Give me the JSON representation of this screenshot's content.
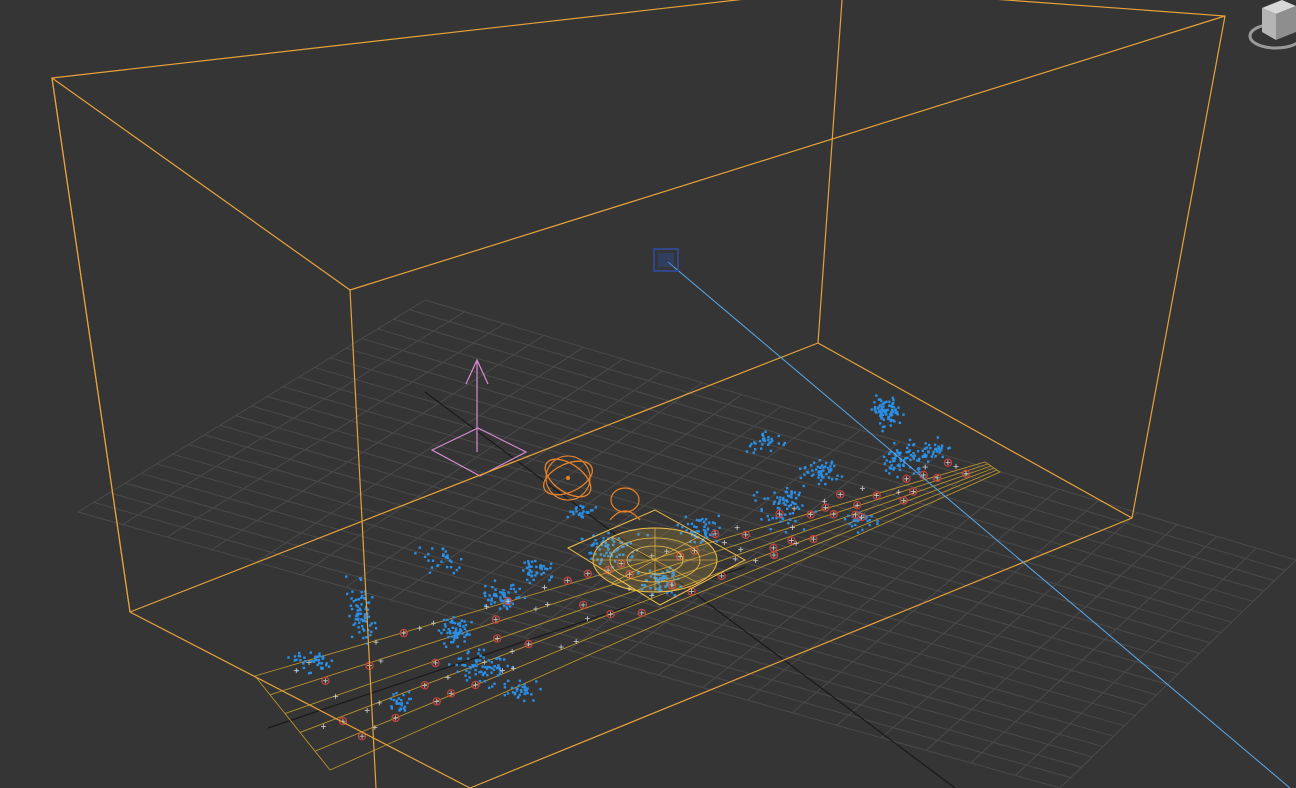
{
  "app": "3D viewport",
  "viewport": {
    "name": "perspective-viewport",
    "background": "#353535"
  },
  "colors": {
    "grid": "#4a4a4a",
    "bounding_box": "#e6a23a",
    "strip": "#b8922e",
    "particles": "#2b8fe6",
    "markers": "#c9413c",
    "marker_cross": "#cfcfcf",
    "light_ray": "#5aa8e6",
    "helper_gizmo": "#d98ad4",
    "selected_object": "#f2c04a",
    "camera_target": "#2e4fa8"
  },
  "icons": {
    "view_cube": "view-cube-icon",
    "camera_target": "camera-target-icon",
    "helper": "point-helper-icon",
    "atom_emitter": "atom-emitter-icon"
  }
}
